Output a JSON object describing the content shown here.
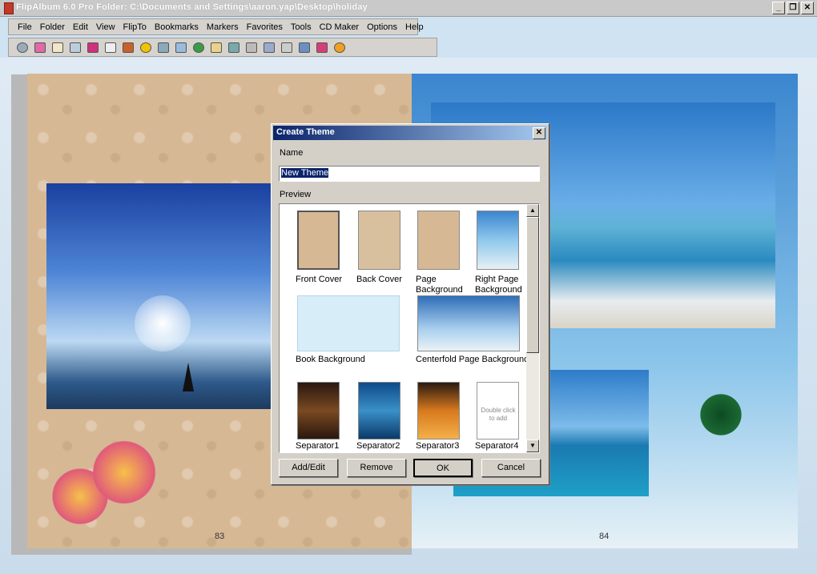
{
  "window": {
    "title": "FlipAlbum 6.0 Pro   Folder: C:\\Documents and Settings\\aaron.yap\\Desktop\\holiday",
    "minimize": "_",
    "restore": "❐",
    "close": "✕"
  },
  "menu": [
    "File",
    "Folder",
    "Edit",
    "View",
    "FlipTo",
    "Bookmarks",
    "Markers",
    "Favorites",
    "Tools",
    "CD Maker",
    "Options",
    "Help"
  ],
  "toolbar_icons": [
    "open-icon",
    "close-book-icon",
    "book-icon",
    "contents-icon",
    "flip-icon",
    "index-icon",
    "print-icon",
    "bookmark-icon",
    "search-icon",
    "columns-icon",
    "link-icon",
    "notes-icon",
    "zoom-icon",
    "fit-icon",
    "film-icon",
    "frame-icon",
    "share-icon",
    "marker-icon",
    "cd-icon"
  ],
  "colors": {
    "accent": "#0a246a",
    "dialog": "#d4d0c8",
    "page": "#d6b895"
  },
  "pages": {
    "left_number": "83",
    "right_number": "84"
  },
  "dialog": {
    "title": "Create Theme",
    "name_label": "Name",
    "name_value": "New Theme",
    "preview_label": "Preview",
    "thumbnails": [
      {
        "label": "Front Cover"
      },
      {
        "label": "Back Cover"
      },
      {
        "label": "Page\nBackground"
      },
      {
        "label": "Right Page\nBackground"
      },
      {
        "label": "Book Background"
      },
      {
        "label": "Centerfold Page Background"
      },
      {
        "label": "Separator1"
      },
      {
        "label": "Separator2"
      },
      {
        "label": "Separator3"
      },
      {
        "label": "Separator4"
      }
    ],
    "placeholder_text": "Double click to add",
    "buttons": {
      "add_edit": "Add/Edit",
      "remove": "Remove",
      "ok": "OK",
      "cancel": "Cancel"
    }
  }
}
